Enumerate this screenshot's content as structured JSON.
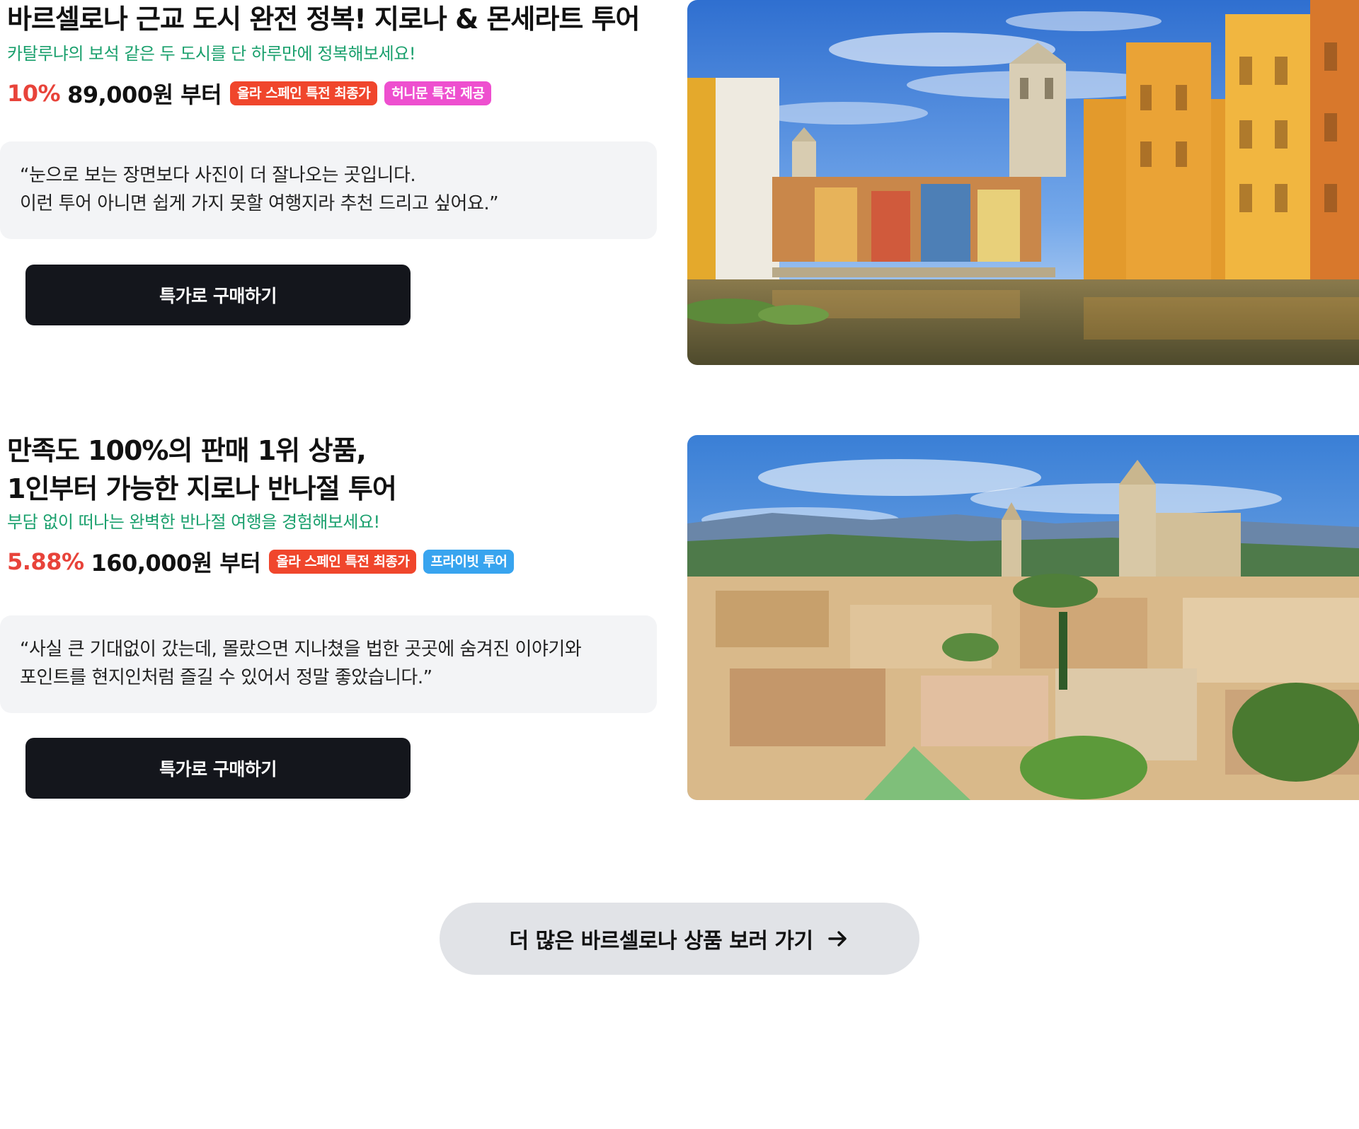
{
  "products": [
    {
      "title_lines": [
        "바르셀로나 근교 도시 완전 정복! 지로나 & 몬세라트 투어"
      ],
      "subtitle": "카탈루냐의 보석 같은 두 도시를 단 하루만에 정복해보세요!",
      "discount": "10%",
      "price": "89,000원 부터",
      "badges": [
        {
          "label": "올라 스페인 특전 최종가",
          "color": "#f0462c"
        },
        {
          "label": "허니문 특전 제공",
          "color": "#ee4fcf"
        }
      ],
      "review_lines": [
        "“눈으로 보는 장면보다 사진이 더 잘나오는 곳입니다.",
        "이런 투어 아니면 쉽게 가지 못할 여행지라 추천 드리고 싶어요.”"
      ],
      "button_label": "특가로 구매하기",
      "image_alt": "colorful-riverside-houses-photo"
    },
    {
      "title_lines": [
        "만족도 100%의 판매 1위 상품,",
        "1인부터 가능한 지로나 반나절 투어"
      ],
      "subtitle": "부담 없이 떠나는 완벽한 반나절 여행을 경험해보세요!",
      "discount": "5.88%",
      "price": "160,000원 부터",
      "badges": [
        {
          "label": "올라 스페인 특전 최종가",
          "color": "#f0462c"
        },
        {
          "label": "프라이빗 투어",
          "color": "#38a4ef"
        }
      ],
      "review_lines": [
        "“사실 큰 기대없이 갔는데, 몰랐으면 지나쳤을 법한 곳곳에 숨겨진 이야기와",
        "포인트를 현지인처럼 즐길 수 있어서 정말 좋았습니다.”"
      ],
      "button_label": "특가로 구매하기",
      "image_alt": "old-town-panorama-photo"
    }
  ],
  "more_button": {
    "label": "더 많은 바르셀로나 상품 보러 가기",
    "icon": "arrow-right-icon"
  }
}
